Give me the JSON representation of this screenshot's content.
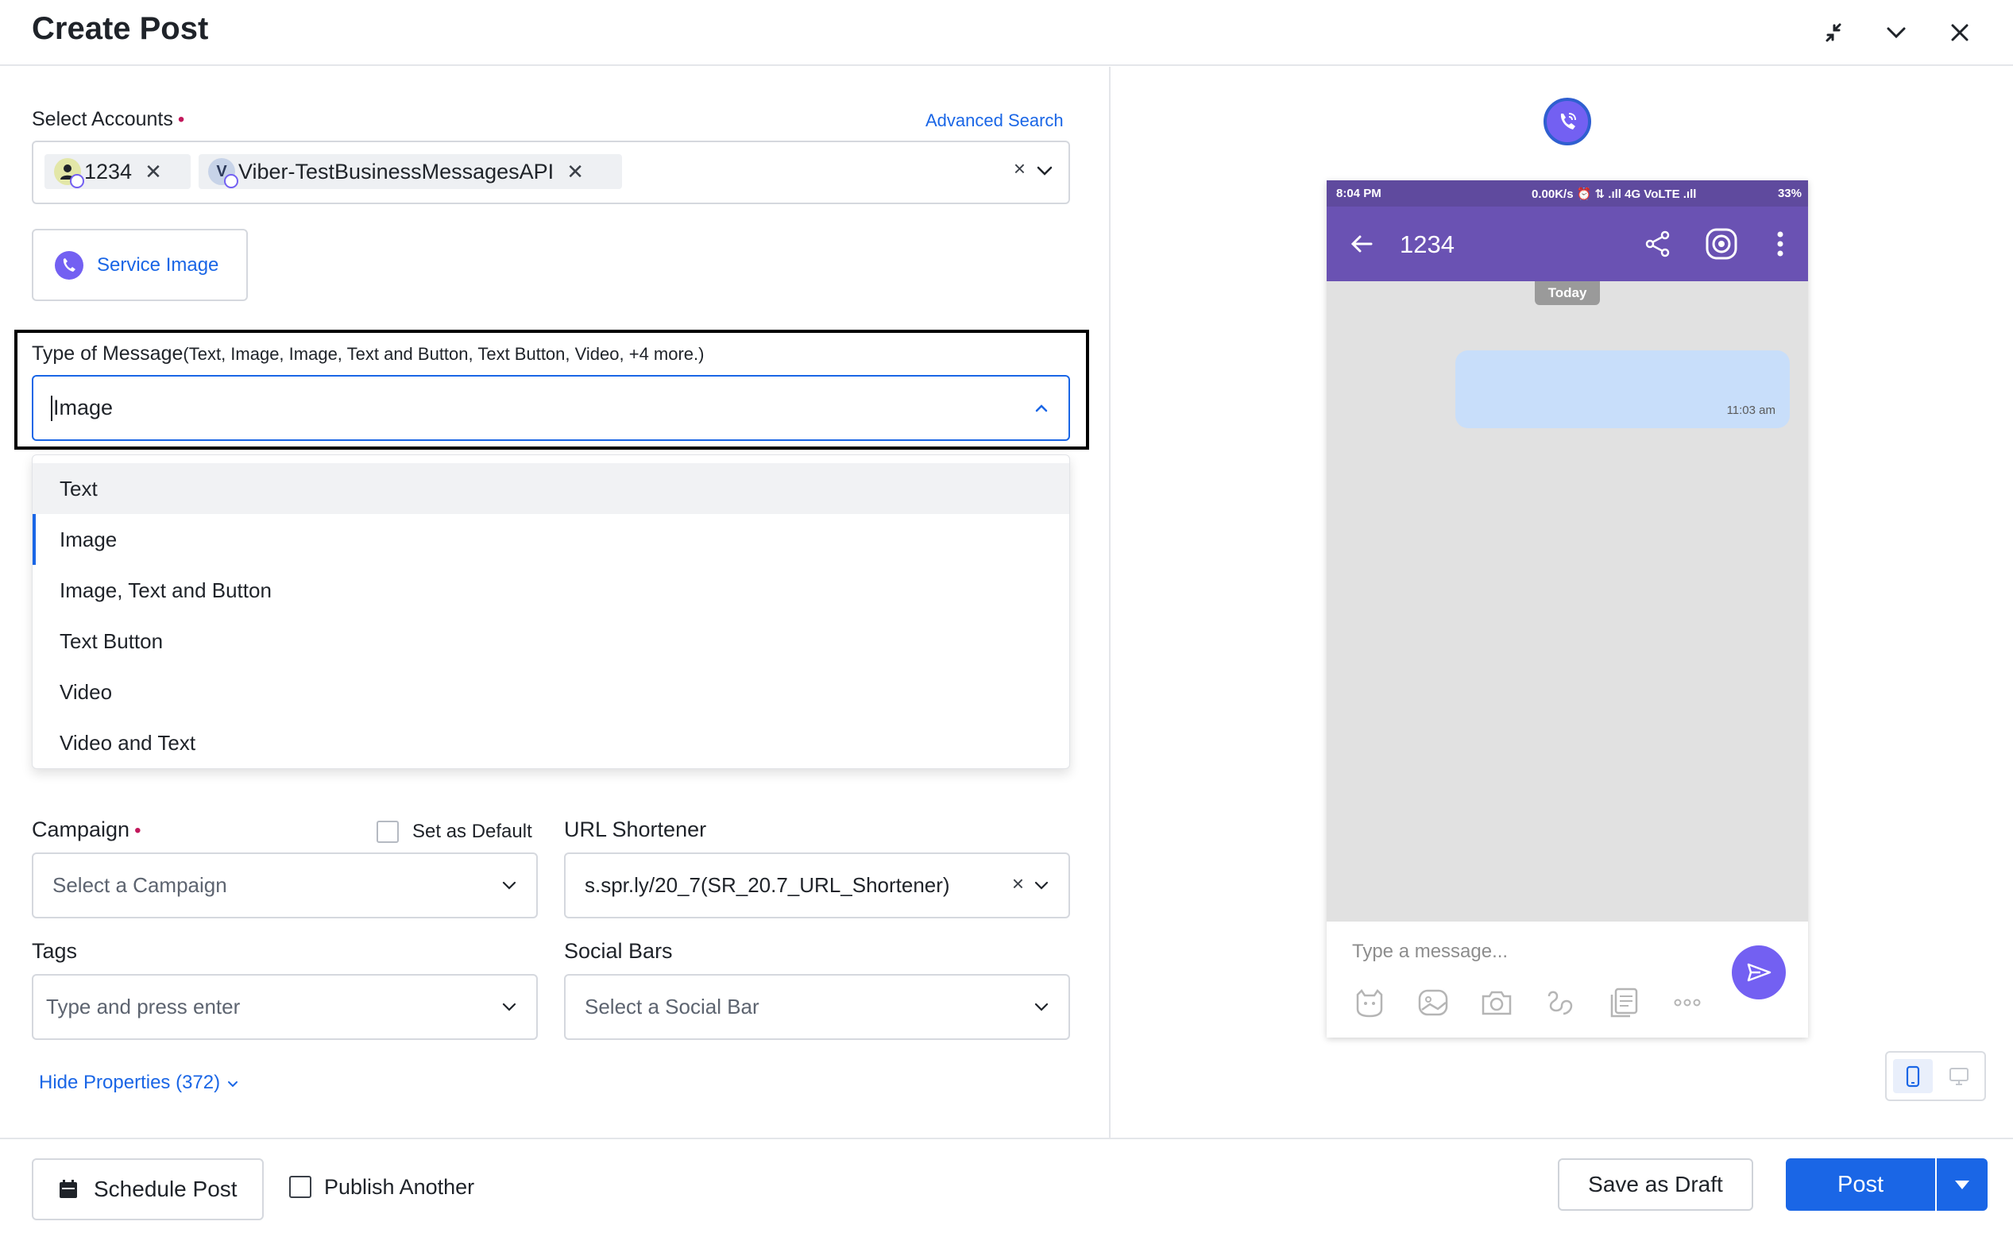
{
  "header": {
    "title": "Create Post",
    "icons": [
      "collapse-icon",
      "chevron-down-icon",
      "close-icon"
    ]
  },
  "accounts": {
    "label": "Select Accounts",
    "required_mark": "•",
    "advanced_search": "Advanced Search",
    "chips": [
      {
        "label": "1234",
        "avatar_letter": ""
      },
      {
        "label": "Viber-TestBusinessMessagesAPI",
        "avatar_letter": "V"
      }
    ],
    "clear_symbol": "×"
  },
  "service_image": {
    "label": "Service Image"
  },
  "message_type": {
    "label": "Type of Message",
    "summary": "(Text, Image, Image, Text and Button, Text Button, Video, +4 more.)",
    "value": "Image",
    "options": [
      "Text",
      "Image",
      "Image, Text and Button",
      "Text Button",
      "Video",
      "Video and Text"
    ],
    "hovered": "Text",
    "selected": "Image"
  },
  "campaign": {
    "label": "Campaign",
    "required_mark": "•",
    "set_default_label": "Set as Default",
    "placeholder": "Select a Campaign"
  },
  "url_shortener": {
    "label": "URL Shortener",
    "value": "s.spr.ly/20_7(SR_20.7_URL_Shortener)",
    "clear_symbol": "×"
  },
  "tags": {
    "label": "Tags",
    "placeholder": "Type and press enter"
  },
  "social_bars": {
    "label": "Social Bars",
    "placeholder": "Select a Social Bar"
  },
  "properties": {
    "label": "Hide Properties (372)"
  },
  "footer": {
    "schedule_label": "Schedule Post",
    "publish_another_label": "Publish Another",
    "save_draft_label": "Save as Draft",
    "post_label": "Post"
  },
  "preview": {
    "status_time": "8:04 PM",
    "status_network": "0.00K/s  ⏰  ⇅ .ıll 4G VoLTE .ıll",
    "status_battery": "33%",
    "chat_title": "1234",
    "today_label": "Today",
    "bubble_time": "11:03 am",
    "composer_placeholder": "Type a message..."
  },
  "colors": {
    "accent": "#1a66e6",
    "viber_purple": "#7360f2",
    "viber_header": "#6a52b3",
    "required": "#c2185b"
  }
}
